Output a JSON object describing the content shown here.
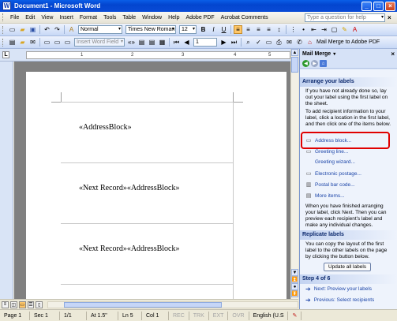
{
  "window": {
    "title": "Document1 - Microsoft Word",
    "app_icon": "W",
    "minimize": "_",
    "maximize": "□",
    "close": "×"
  },
  "menubar": {
    "items": [
      "File",
      "Edit",
      "View",
      "Insert",
      "Format",
      "Tools",
      "Table",
      "Window",
      "Help",
      "Adobe PDF",
      "Acrobat Comments"
    ],
    "help_placeholder": "Type a question for help",
    "close_doc": "×"
  },
  "toolbar1": {
    "style": "Normal",
    "font": "Times New Roman",
    "size": "12",
    "bold": "B",
    "italic": "I",
    "underline": "U",
    "font_color_label": "A"
  },
  "toolbar2": {
    "insert_word_field": "Insert Word Field",
    "record_number": "1",
    "mail_merge_to_pdf": "Mail Merge to Adobe PDF"
  },
  "ruler": {
    "corner": "L",
    "numbers": [
      "1",
      "2",
      "3",
      "4",
      "5"
    ]
  },
  "document": {
    "cells": [
      "«AddressBlock»",
      "«Next Record»«AddressBlock»",
      "«Next Record»«AddressBlock»"
    ]
  },
  "statusbar": {
    "page": "Page 1",
    "section": "Sec 1",
    "pages": "1/1",
    "at": "At 1.5\"",
    "line": "Ln 5",
    "col": "Col 1",
    "rec": "REC",
    "trk": "TRK",
    "ext": "EXT",
    "ovr": "OVR",
    "language": "English (U.S"
  },
  "taskpane": {
    "title": "Mail Merge",
    "section1_title": "Arrange your labels",
    "para1": "If you have not already done so, lay out your label using the first label on the sheet.",
    "para2": "To add recipient information to your label, click a location in the first label, and then click one of the items below.",
    "links": [
      "Address block...",
      "Greeting line...",
      "Greeting wizard...",
      "Electronic postage...",
      "Postal bar code...",
      "More items..."
    ],
    "para3": "When you have finished arranging your label, click Next. Then you can preview each recipient's label and make any individual changes.",
    "section2_title": "Replicate labels",
    "para4": "You can copy the layout of the first label to the other labels on the page by clicking the button below.",
    "update_button": "Update all labels",
    "step_title": "Step 4 of 6",
    "next": "Next: Preview your labels",
    "previous": "Previous: Select recipients"
  }
}
